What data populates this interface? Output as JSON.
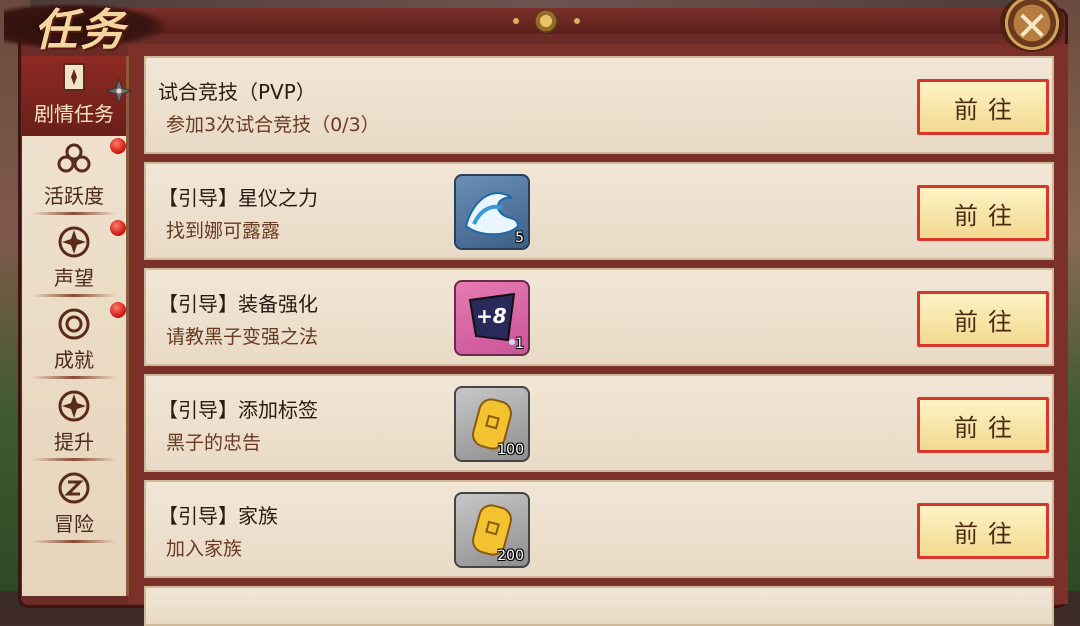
{
  "window": {
    "title": "任务"
  },
  "sidebar": {
    "items": [
      {
        "label": "剧情任务",
        "icon": "scroll-icon",
        "active": true,
        "badge": false
      },
      {
        "label": "活跃度",
        "icon": "flower-icon",
        "active": false,
        "badge": true
      },
      {
        "label": "声望",
        "icon": "emblem-icon",
        "active": false,
        "badge": true
      },
      {
        "label": "成就",
        "icon": "medal-icon",
        "active": false,
        "badge": true
      },
      {
        "label": "提升",
        "icon": "upgrade-icon",
        "active": false,
        "badge": false
      },
      {
        "label": "冒险",
        "icon": "adventure-icon",
        "active": false,
        "badge": false
      }
    ]
  },
  "tasks": [
    {
      "title": "试合竞技（PVP）",
      "subtitle": "参加3次试合竞技（0/3）",
      "reward": null,
      "button": "前往"
    },
    {
      "title": "【引导】星仪之力",
      "subtitle": "找到娜可露露",
      "reward": {
        "icon": "water-wave-icon",
        "count": "5",
        "style": "blue"
      },
      "button": "前往"
    },
    {
      "title": "【引导】装备强化",
      "subtitle": "请教黑子变强之法",
      "reward": {
        "icon": "enhance-scroll-icon",
        "count": "1",
        "style": "purple",
        "text": "+8"
      },
      "button": "前往"
    },
    {
      "title": "【引导】添加标签",
      "subtitle": "黑子的忠告",
      "reward": {
        "icon": "gold-coin-icon",
        "count": "100",
        "style": "gray"
      },
      "button": "前往"
    },
    {
      "title": "【引导】家族",
      "subtitle": "加入家族",
      "reward": {
        "icon": "gold-coin-icon",
        "count": "200",
        "style": "gray"
      },
      "button": "前往"
    }
  ],
  "colors": {
    "frame": "#6b2b26",
    "button_border": "#d8352b",
    "badge": "#d2201a",
    "active_tab": "#8e2a23"
  }
}
